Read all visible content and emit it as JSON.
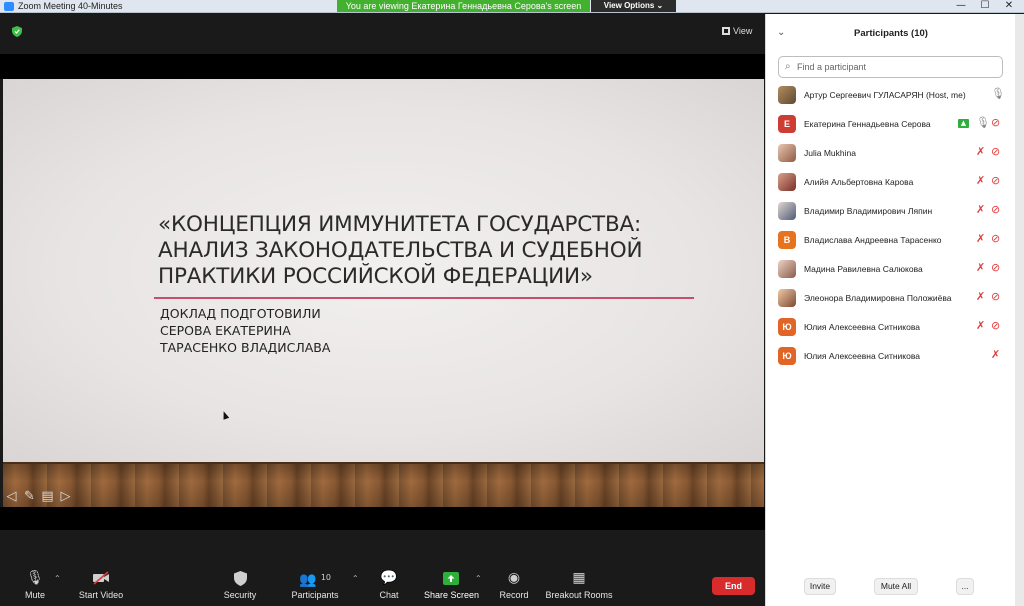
{
  "window": {
    "title": "Zoom Meeting 40-Minutes",
    "banner": "You are viewing Екатерина Геннадьевна Серова's screen",
    "view_options": "View Options ⌄",
    "controls": {
      "minimize": "—",
      "maximize": "☐",
      "close": "✕"
    }
  },
  "video": {
    "view_label": "View",
    "slide": {
      "title": "«КОНЦЕПЦИЯ ИММУНИТЕТА ГОСУДАРСТВА: АНАЛИЗ ЗАКОНОДАТЕЛЬСТВА И СУДЕБНОЙ ПРАКТИКИ РОССИЙСКОЙ ФЕДЕРАЦИИ»",
      "subtitle_lines": [
        "ДОКЛАД ПОДГОТОВИЛИ",
        "СЕРОВА ЕКАТЕРИНА",
        "ТАРАСЕНКО ВЛАДИСЛАВА"
      ],
      "accent_line_color": "#c74f6b"
    }
  },
  "toolbar": {
    "mute": "Mute",
    "start_video": "Start Video",
    "security": "Security",
    "participants": "Participants",
    "participants_count": "10",
    "chat": "Chat",
    "share_screen": "Share Screen",
    "record": "Record",
    "breakout_rooms": "Breakout Rooms",
    "end": "End",
    "end_color": "#d82c2c",
    "share_color": "#2eae3a"
  },
  "panel": {
    "title": "Participants (10)",
    "search_placeholder": "Find a participant",
    "participants": [
      {
        "name": "Артур Сергеевич ГУЛАСАРЯН (Host, me)",
        "initial": "",
        "avatar_color": "",
        "mic_muted": false,
        "video_off": false
      },
      {
        "name": "Екатерина Геннадьевна Серова",
        "initial": "Е",
        "avatar_color": "#cc3d33",
        "sharing": true,
        "mic_muted": false,
        "video_off": true
      },
      {
        "name": "Julia Mukhina",
        "initial": "",
        "avatar_color": "",
        "mic_muted": true,
        "video_off": true
      },
      {
        "name": "Алийя Альбертовна Карова",
        "initial": "",
        "avatar_color": "",
        "mic_muted": true,
        "video_off": true
      },
      {
        "name": "Владимир Владимирович Ляпин",
        "initial": "",
        "avatar_color": "",
        "mic_muted": true,
        "video_off": true
      },
      {
        "name": "Владислава Андреевна Тарасенко",
        "initial": "В",
        "avatar_color": "#e8731e",
        "mic_muted": true,
        "video_off": true
      },
      {
        "name": "Мадина Равилевна Салюкова",
        "initial": "",
        "avatar_color": "",
        "mic_muted": true,
        "video_off": true
      },
      {
        "name": "Элеонора Владимировна Положиёва",
        "initial": "",
        "avatar_color": "",
        "mic_muted": true,
        "video_off": true
      },
      {
        "name": "Юлия Алексеевна Ситникова",
        "initial": "Ю",
        "avatar_color": "#e06526",
        "mic_muted": true,
        "video_off": true
      },
      {
        "name": "Юлия Алексеевна Ситникова",
        "initial": "Ю",
        "avatar_color": "#e06526",
        "mic_muted": true,
        "video_off": false
      }
    ],
    "invite": "Invite",
    "mute_all": "Mute All",
    "more": "..."
  }
}
